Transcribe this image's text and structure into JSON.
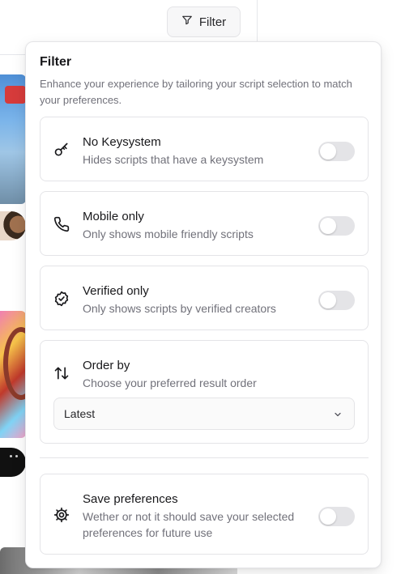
{
  "topbar": {
    "filter_button_label": "Filter"
  },
  "panel": {
    "title": "Filter",
    "description": "Enhance your experience by tailoring your script selection to match your preferences.",
    "options": [
      {
        "title": "No Keysystem",
        "subtitle": "Hides scripts that have a keysystem",
        "icon": "key-icon",
        "enabled": false
      },
      {
        "title": "Mobile only",
        "subtitle": "Only shows mobile friendly scripts",
        "icon": "phone-icon",
        "enabled": false
      },
      {
        "title": "Verified only",
        "subtitle": "Only shows scripts by verified creators",
        "icon": "verified-badge-icon",
        "enabled": false
      }
    ],
    "order_by": {
      "title": "Order by",
      "subtitle": "Choose your preferred result order",
      "icon": "sort-arrows-icon",
      "selected": "Latest"
    },
    "save_preferences": {
      "title": "Save preferences",
      "subtitle": "Wether or not it should save your selected preferences for future use",
      "icon": "gear-icon",
      "enabled": false
    }
  },
  "colors": {
    "toggle_off": "#e4e4e7",
    "muted_text": "#71717a",
    "border": "#e4e4e7"
  }
}
